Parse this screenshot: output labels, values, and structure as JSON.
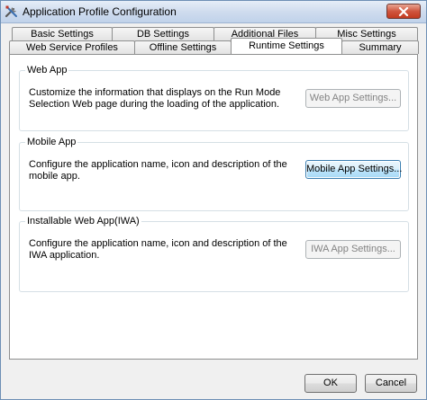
{
  "window": {
    "title": "Application Profile Configuration"
  },
  "tabs": {
    "row1": [
      {
        "label": "Basic Settings"
      },
      {
        "label": "DB Settings"
      },
      {
        "label": "Additional Files"
      },
      {
        "label": "Misc Settings"
      }
    ],
    "row2": [
      {
        "label": "Web Service Profiles"
      },
      {
        "label": "Offline Settings"
      },
      {
        "label": "Runtime Settings"
      },
      {
        "label": "Summary"
      }
    ],
    "active": "Runtime Settings"
  },
  "groups": {
    "web_app": {
      "title": "Web App",
      "description": "Customize the information that displays on the Run Mode Selection Web page during the loading of the application.",
      "button": "Web App Settings...",
      "button_enabled": false
    },
    "mobile_app": {
      "title": "Mobile App",
      "description": "Configure the application name, icon and description of the mobile app.",
      "button": "Mobile App Settings...",
      "button_enabled": true
    },
    "iwa": {
      "title": "Installable Web App(IWA)",
      "description": "Configure the application name, icon and description of the IWA application.",
      "button": "IWA App Settings...",
      "button_enabled": false
    }
  },
  "footer": {
    "ok": "OK",
    "cancel": "Cancel"
  },
  "icons": {
    "app": "tools-icon",
    "close": "close-icon"
  },
  "colors": {
    "close_button": "#c23a20",
    "title_bar": "#cfdcee",
    "focus_border": "#3c7fb1"
  }
}
